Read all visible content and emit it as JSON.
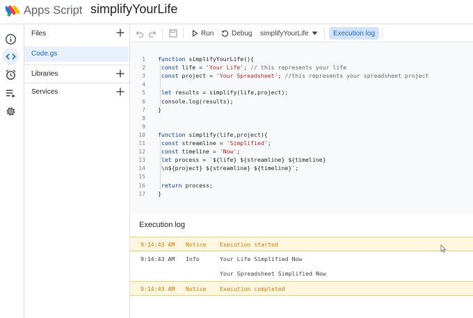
{
  "header": {
    "app_name": "Apps Script",
    "project_title": "simplifyYourLife"
  },
  "rail": {
    "items": [
      {
        "name": "overview",
        "icon": "info-icon",
        "active": false
      },
      {
        "name": "editor",
        "icon": "code-icon",
        "active": true
      },
      {
        "name": "triggers",
        "icon": "alarm-clock-icon",
        "active": false
      },
      {
        "name": "executions",
        "icon": "executions-list-icon",
        "active": false
      },
      {
        "name": "settings",
        "icon": "gear-icon",
        "active": false
      }
    ]
  },
  "files_panel": {
    "files_label": "Files",
    "files": [
      "Code.gs"
    ],
    "libraries_label": "Libraries",
    "services_label": "Services"
  },
  "toolbar": {
    "run_label": "Run",
    "debug_label": "Debug",
    "function_select": "simplifyYourLife",
    "execution_log_label": "Execution log"
  },
  "editor": {
    "lines": [
      {
        "n": "1",
        "tokens": [
          {
            "t": "function",
            "c": "kw"
          },
          {
            "t": " simplifyYourLife(){",
            "c": ""
          }
        ]
      },
      {
        "n": "2",
        "tokens": [
          {
            "t": " const",
            "c": "kw"
          },
          {
            "t": " life = ",
            "c": ""
          },
          {
            "t": "'Your Life'",
            "c": "str"
          },
          {
            "t": "; ",
            "c": ""
          },
          {
            "t": "// this represents your life",
            "c": "cm"
          }
        ]
      },
      {
        "n": "3",
        "tokens": [
          {
            "t": " const",
            "c": "kw"
          },
          {
            "t": " project = ",
            "c": ""
          },
          {
            "t": "'Your Spreadsheet'",
            "c": "str"
          },
          {
            "t": "; ",
            "c": ""
          },
          {
            "t": "//this represents your spreadsheet project",
            "c": "cm"
          }
        ]
      },
      {
        "n": "4",
        "tokens": []
      },
      {
        "n": "5",
        "tokens": [
          {
            "t": " let",
            "c": "kw"
          },
          {
            "t": " results = simplify(life,project);",
            "c": ""
          }
        ]
      },
      {
        "n": "6",
        "tokens": [
          {
            "t": " console.log(results);",
            "c": ""
          }
        ]
      },
      {
        "n": "7",
        "tokens": [
          {
            "t": "}",
            "c": ""
          }
        ]
      },
      {
        "n": "8",
        "tokens": []
      },
      {
        "n": "9",
        "tokens": []
      },
      {
        "n": "10",
        "tokens": [
          {
            "t": "function",
            "c": "kw"
          },
          {
            "t": " simplify(life,project){",
            "c": ""
          }
        ]
      },
      {
        "n": "11",
        "tokens": [
          {
            "t": " const",
            "c": "kw"
          },
          {
            "t": " streamline = ",
            "c": ""
          },
          {
            "t": "'Simplified'",
            "c": "str"
          },
          {
            "t": ";",
            "c": ""
          }
        ]
      },
      {
        "n": "12",
        "tokens": [
          {
            "t": " const",
            "c": "kw"
          },
          {
            "t": " timeline = ",
            "c": ""
          },
          {
            "t": "'Now'",
            "c": "str"
          },
          {
            "t": ";",
            "c": ""
          }
        ]
      },
      {
        "n": "13",
        "tokens": [
          {
            "t": " let",
            "c": "kw"
          },
          {
            "t": " process = `${life} ${streamline} ${timeline}",
            "c": ""
          }
        ]
      },
      {
        "n": "14",
        "tokens": [
          {
            "t": " \\n${project} ${streamline} ${timeline}`;",
            "c": ""
          }
        ]
      },
      {
        "n": "15",
        "tokens": []
      },
      {
        "n": "16",
        "tokens": [
          {
            "t": " return",
            "c": "kw"
          },
          {
            "t": " process;",
            "c": ""
          }
        ]
      },
      {
        "n": "17",
        "tokens": [
          {
            "t": "}",
            "c": ""
          }
        ]
      }
    ]
  },
  "execution_log": {
    "title": "Execution log",
    "rows": [
      {
        "time": "9:14:43 AM",
        "severity": "Notice",
        "message": "Execution started",
        "highlight": true
      },
      {
        "time": "9:14:43 AM",
        "severity": "Info",
        "message": "Your Life Simplified Now",
        "highlight": false
      },
      {
        "time": "",
        "severity": "",
        "message": "Your Spreadsheet Simplified Now",
        "highlight": false
      },
      {
        "time": "9:14:43 AM",
        "severity": "Notice",
        "message": "Execution completed",
        "highlight": true
      }
    ]
  },
  "colors": {
    "accent": "#1967d2",
    "active_bg": "#e8f0fe",
    "notice_text": "#e37400",
    "notice_bg": "#fef7e0",
    "keyword": "#0033b3",
    "string": "#c5221f"
  }
}
